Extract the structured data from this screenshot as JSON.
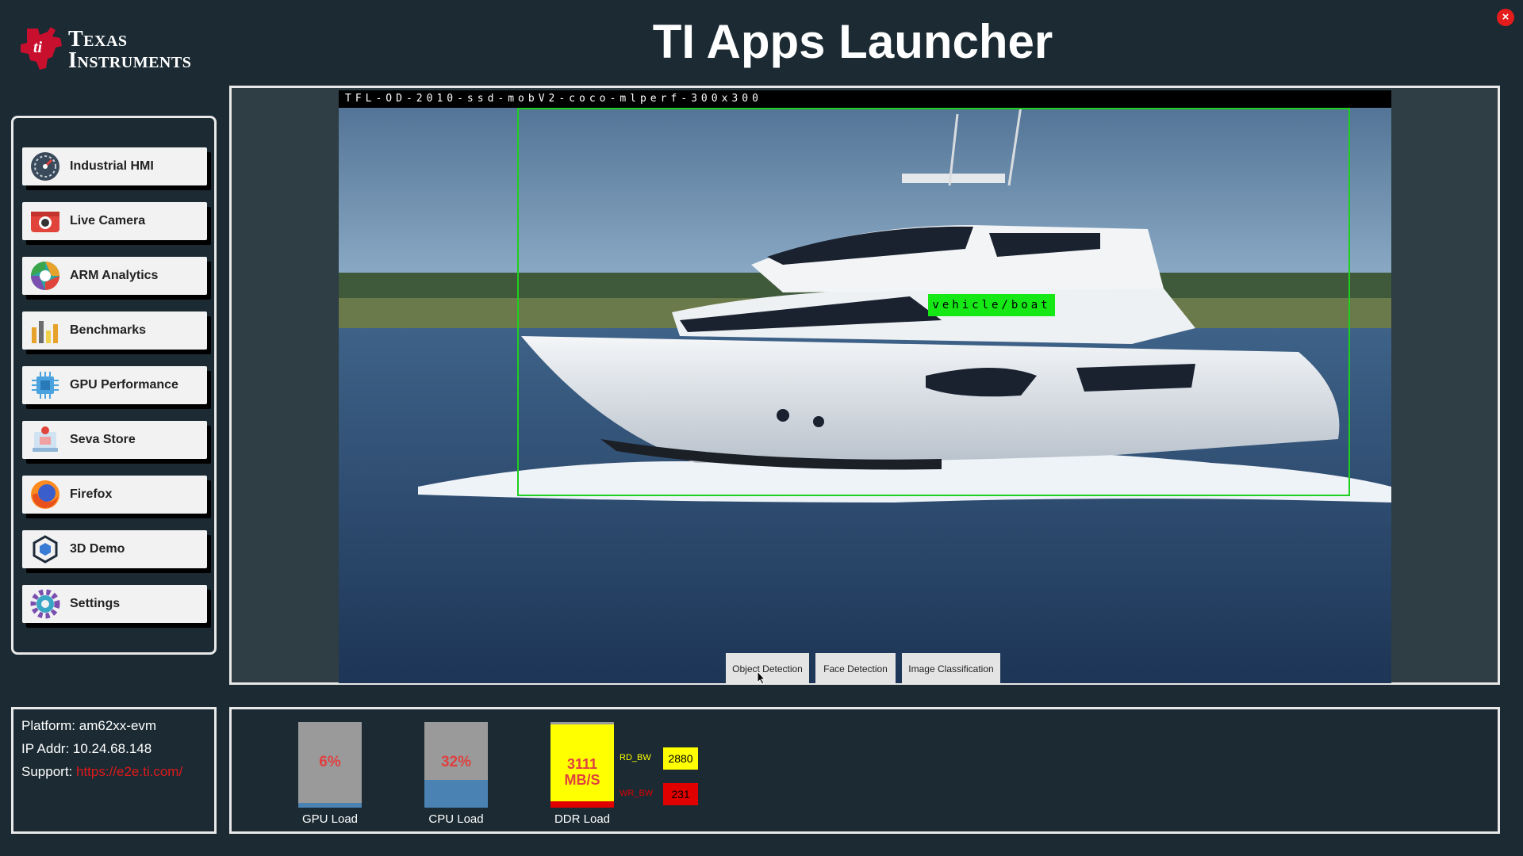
{
  "header": {
    "title": "TI Apps Launcher",
    "logo_line1": "Texas",
    "logo_line2": "Instruments",
    "close_symbol": "×"
  },
  "sidebar": {
    "items": [
      {
        "label": "Industrial HMI",
        "icon": "gauge-icon"
      },
      {
        "label": "Live Camera",
        "icon": "camera-icon"
      },
      {
        "label": "ARM Analytics",
        "icon": "aperture-icon"
      },
      {
        "label": "Benchmarks",
        "icon": "bar-chart-icon"
      },
      {
        "label": "GPU Performance",
        "icon": "chip-icon"
      },
      {
        "label": "Seva Store",
        "icon": "store-icon"
      },
      {
        "label": "Firefox",
        "icon": "firefox-icon"
      },
      {
        "label": "3D Demo",
        "icon": "cube-icon"
      },
      {
        "label": "Settings",
        "icon": "gear-icon"
      }
    ]
  },
  "video": {
    "model_name": "TFL-OD-2010-ssd-mobV2-coco-mlperf-300x300",
    "detection_label": "vehicle/boat",
    "box_color": "#1ed01e",
    "tabs": [
      "Object Detection",
      "Face Detection",
      "Image Classification"
    ]
  },
  "info": {
    "platform_label": "Platform:",
    "platform_value": "am62xx-evm",
    "ip_label": "IP Addr:",
    "ip_value": "10.24.68.148",
    "support_label": "Support:",
    "support_value": "https://e2e.ti.com/"
  },
  "stats": {
    "gpu": {
      "label": "GPU Load",
      "value_text": "6%",
      "value": 0.06,
      "fill_color": "#4a82b4"
    },
    "cpu": {
      "label": "CPU Load",
      "value_text": "32%",
      "value": 0.32,
      "fill_color": "#4a82b4"
    },
    "ddr": {
      "label": "DDR Load",
      "value": "3111",
      "unit": "MB/S",
      "rd_label": "RD_BW",
      "rd_value": "2880",
      "wr_label": "WR_BW",
      "wr_value": "231",
      "rd_color": "#ffff00",
      "wr_color": "#e00000"
    }
  }
}
